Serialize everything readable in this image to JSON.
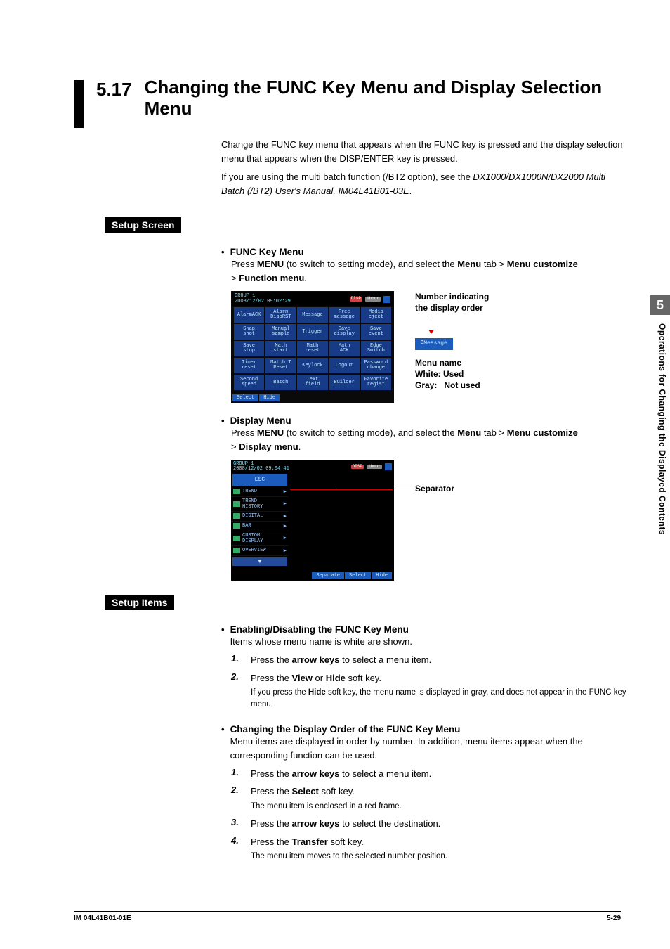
{
  "side_tab": "5",
  "side_text": "Operations for Changing the Displayed Contents",
  "section_number": "5.17",
  "section_title": "Changing the FUNC Key Menu and Display Selection Menu",
  "intro1": "Change the FUNC key menu that appears when the FUNC key is pressed and the display selection menu that appears when the DISP/ENTER key is pressed.",
  "intro2a": "If you are using the multi batch function (/BT2 option), see the ",
  "intro2b": "DX1000/DX1000N/DX2000 Multi Batch (/BT2) User's Manual, IM04L41B01-03E",
  "setup_screen_label": "Setup Screen",
  "func_key_heading": "FUNC Key Menu",
  "func_nav_a": "Press ",
  "func_nav_menu": "MENU",
  "func_nav_b": " (to switch to setting mode), and select the ",
  "func_nav_tab": "Menu",
  "func_nav_c": " tab > ",
  "func_nav_cust": "Menu customize",
  "func_nav_d": " > ",
  "func_nav_fm": "Function menu",
  "ds1_header_left": "GROUP 1\n2008/12/02 09:02:29",
  "ds1_disp": "DISP",
  "ds1_time": "1hour",
  "grid": [
    "AlarmACK",
    "Alarm\nDispRST",
    "Message",
    "Free\nmessage",
    "Media\neject",
    "Snap\nshot",
    "Manual\nsample",
    "Trigger",
    "Save\ndisplay",
    "Save\nevent",
    "Save\nstop",
    "Math\nstart",
    "Math\nreset",
    "Math\nACK",
    "Edge\nSwitch",
    "Timer\nreset",
    "Match T\nReset",
    "Keylock",
    "Logout",
    "Password\nchange",
    "Second\nspeed",
    "Batch",
    "Text\nfield",
    "Builder",
    "Favorite\nregist"
  ],
  "soft1a": "Select",
  "soft1b": "Hide",
  "anno1_l1": "Number indicating",
  "anno1_l2": "the display order",
  "msg_chip_num": "3",
  "msg_chip_label": "Message",
  "anno2_l1": "Menu name",
  "anno2_l2": "White: Used",
  "anno2_l3": "Gray:   Not used",
  "display_menu_heading": "Display Menu",
  "disp_nav_b": " (to switch to setting mode), and select the ",
  "disp_nav_fm": "Display menu",
  "ds2_header_left": "GROUP 1\n2008/12/02 09:04:41",
  "ds2_esc": "ESC",
  "ds2_items": [
    "TREND",
    "TREND\nHISTORY",
    "DIGITAL",
    "BAR",
    "CUSTOM\nDISPLAY",
    "OVERVIEW"
  ],
  "ds2_soft": [
    "Separate",
    "Select",
    "Hide"
  ],
  "separator_label": "Separator",
  "setup_items_label": "Setup Items",
  "enable_heading": "Enabling/Disabling the FUNC Key Menu",
  "enable_sub": "Items whose menu name is white are shown.",
  "en1_a": "Press the ",
  "en1_b": "arrow keys",
  "en1_c": " to select a menu item.",
  "en2_a": "Press the ",
  "en2_b": "View",
  "en2_c": " or ",
  "en2_d": "Hide",
  "en2_e": " soft key.",
  "en2_sub_a": "If you press the ",
  "en2_sub_b": "Hide",
  "en2_sub_c": " soft key, the menu name is displayed in gray, and does not appear in the FUNC key menu.",
  "order_heading": "Changing the Display Order of the FUNC Key Menu",
  "order_sub": "Menu items are displayed in order by number. In addition, menu items appear when the corresponding function can be used.",
  "or1_a": "Press the ",
  "or1_b": "arrow keys",
  "or1_c": " to select a menu item.",
  "or2_a": "Press the ",
  "or2_b": "Select",
  "or2_c": " soft key.",
  "or2_sub": "The menu item is enclosed in a red frame.",
  "or3_a": "Press the ",
  "or3_b": "arrow keys",
  "or3_c": " to select the destination.",
  "or4_a": "Press the ",
  "or4_b": "Transfer",
  "or4_c": " soft key.",
  "or4_sub": "The menu item moves to the selected number position.",
  "footer_left": "IM 04L41B01-01E",
  "footer_right": "5-29"
}
